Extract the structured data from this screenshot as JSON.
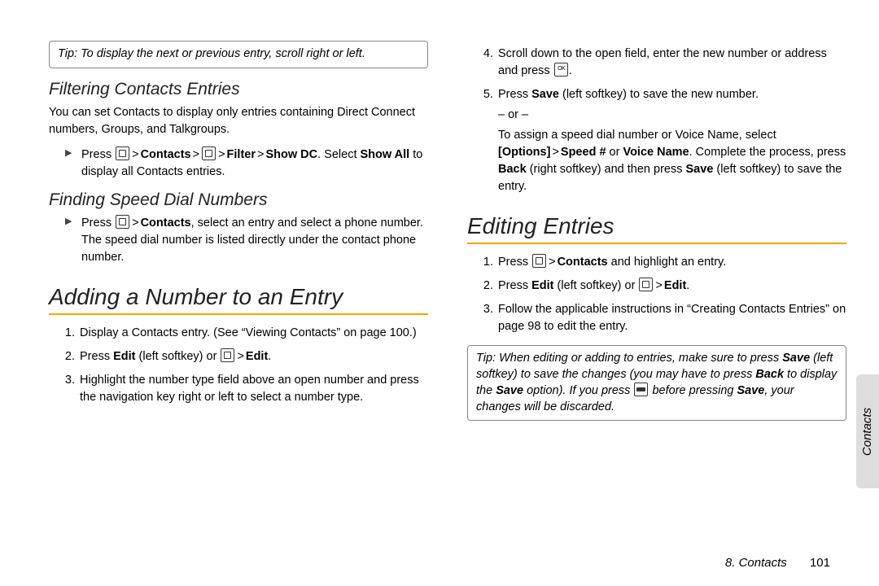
{
  "left": {
    "tip1_label": "Tip:",
    "tip1_text": " To display the next or previous entry, scroll right or left.",
    "h_filter": "Filtering Contacts Entries",
    "p_filter": "You can set Contacts to display only entries containing Direct Connect numbers, Groups, and Talkgroups.",
    "filter_bullet_pre": "Press ",
    "filter_path1": "Contacts",
    "filter_path2": "Filter",
    "filter_path3": "Show DC",
    "filter_bullet_post1": ". Select ",
    "filter_show_all": "Show All",
    "filter_bullet_post2": " to display all Contacts entries.",
    "h_speed": "Finding Speed Dial Numbers",
    "speed_pre": "Press ",
    "speed_contacts": "Contacts",
    "speed_post": ", select an entry and select a phone number. The speed dial number is listed directly under the contact phone number.",
    "h_adding": "Adding a Number to an Entry",
    "add1": "Display a Contacts entry. (See “Viewing Contacts” on page 100.)",
    "add2_pre": "Press ",
    "add2_edit": "Edit",
    "add2_mid": " (left softkey) or ",
    "add2_edit2": "Edit",
    "add2_post": ".",
    "add3": "Highlight the number type field above an open number and press the navigation key right or left to select a number type."
  },
  "right": {
    "s4_pre": "Scroll down to the open field, enter the new number or address and press ",
    "s4_post": ".",
    "s5_pre": "Press ",
    "s5_save": "Save",
    "s5_mid": " (left softkey) to save the new number.",
    "s5_or": "– or –",
    "s5_assign1": "To assign a speed dial number or Voice Name, select ",
    "s5_options": "[Options]",
    "s5_speed": "Speed #",
    "s5_or2": " or ",
    "s5_voice": "Voice Name",
    "s5_post2": ". Complete the process, press ",
    "s5_back": "Back",
    "s5_post3": " (right softkey) and then press ",
    "s5_save2": "Save",
    "s5_post4": " (left softkey) to save the entry.",
    "h_editing": "Editing Entries",
    "e1_pre": "Press ",
    "e1_contacts": "Contacts",
    "e1_post": " and highlight an entry.",
    "e2_pre": "Press ",
    "e2_edit": "Edit",
    "e2_mid": " (left softkey) or ",
    "e2_edit2": "Edit",
    "e2_post": ".",
    "e3": "Follow the applicable instructions in “Creating Contacts Entries” on page 98 to edit the entry.",
    "tip2_label": "Tip:",
    "tip2_a": " When editing or adding to entries, make sure to press ",
    "tip2_save": "Save",
    "tip2_b": " (left softkey) to save the changes (you may have to press ",
    "tip2_back": "Back",
    "tip2_c": " to display the ",
    "tip2_save2": "Save",
    "tip2_d": " option). If you press ",
    "tip2_e": " before pressing ",
    "tip2_save3": "Save",
    "tip2_f": ", your changes will be discarded."
  },
  "footer": {
    "section": "8. Contacts",
    "page": "101"
  },
  "tab": "Contacts",
  "gt": ">"
}
